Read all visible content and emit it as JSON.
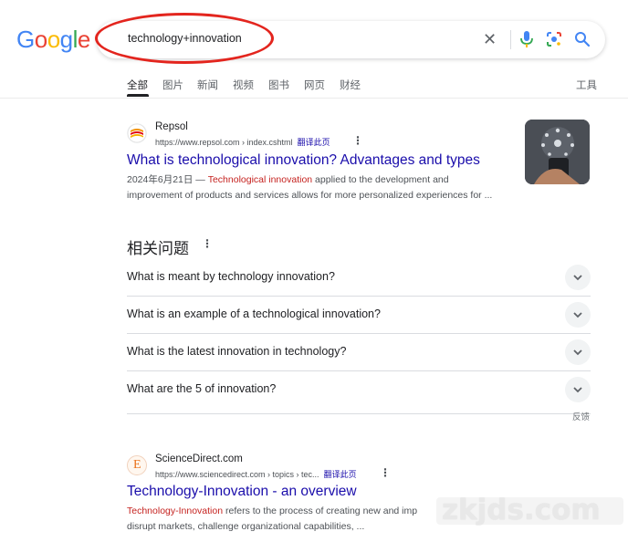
{
  "logo": {
    "letters": [
      "G",
      "o",
      "o",
      "g",
      "l",
      "e"
    ],
    "colors": [
      "#4285f4",
      "#ea4335",
      "#fbbc05",
      "#4285f4",
      "#34a853",
      "#ea4335"
    ]
  },
  "search": {
    "query": "technology+innovation"
  },
  "annotation": {
    "color": "#e3251e"
  },
  "tabs": [
    "全部",
    "图片",
    "新闻",
    "视频",
    "图书",
    "网页",
    "财经"
  ],
  "tools_label": "工具",
  "results": [
    {
      "site_name": "Repsol",
      "url": "https://www.repsol.com › index.cshtml",
      "translate": "翻译此页",
      "title": "What is technological innovation? Advantages and types",
      "snippet_line1_prefix": "2024年6月21日 — ",
      "snippet_line1_highlight": "Technological innovation",
      "snippet_line1_suffix": " applied to the development and",
      "snippet_line2": "improvement of products and services allows for more personalized experiences for ..."
    },
    {
      "site_name": "ScienceDirect.com",
      "favicon_letter": "E",
      "url": "https://www.sciencedirect.com › topics › tec...",
      "translate": "翻译此页",
      "title": "Technology-Innovation - an overview",
      "snippet_line1_highlight": "Technology-Innovation",
      "snippet_line1_suffix": " refers to the process of creating new and imp",
      "snippet_line2": "disrupt markets, challenge organizational capabilities, ..."
    }
  ],
  "people_also_ask": {
    "title": "相关问题",
    "questions": [
      "What is meant by technology innovation?",
      "What is an example of a technological innovation?",
      "What is the latest innovation in technology?",
      "What are the 5 of innovation?"
    ],
    "feedback": "反馈"
  },
  "watermark": "zkjds.com"
}
